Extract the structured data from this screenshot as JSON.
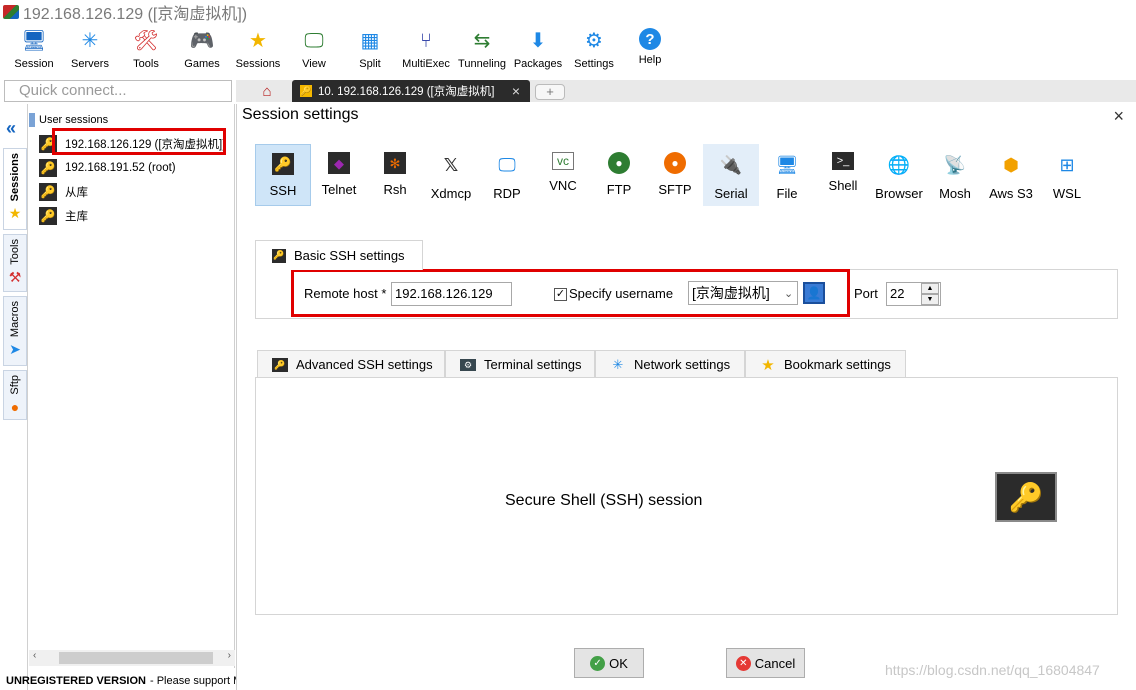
{
  "window": {
    "title": "192.168.126.129 ([京淘虚拟机])"
  },
  "toolbar": [
    {
      "label": "Session",
      "icon": "session-icon",
      "glyph": "🖥"
    },
    {
      "label": "Servers",
      "icon": "servers-icon",
      "glyph": "✳"
    },
    {
      "label": "Tools",
      "icon": "tools-icon",
      "glyph": "🛠"
    },
    {
      "label": "Games",
      "icon": "games-icon",
      "glyph": "🎮"
    },
    {
      "label": "Sessions",
      "icon": "star-icon",
      "glyph": "★"
    },
    {
      "label": "View",
      "icon": "view-icon",
      "glyph": "🖵"
    },
    {
      "label": "Split",
      "icon": "split-icon",
      "glyph": "▦"
    },
    {
      "label": "MultiExec",
      "icon": "multiexec-icon",
      "glyph": "⑂"
    },
    {
      "label": "Tunneling",
      "icon": "tunneling-icon",
      "glyph": "⇆"
    },
    {
      "label": "Packages",
      "icon": "packages-icon",
      "glyph": "⬇"
    },
    {
      "label": "Settings",
      "icon": "gear-icon",
      "glyph": "⚙"
    },
    {
      "label": "Help",
      "icon": "help-icon",
      "glyph": "?"
    }
  ],
  "quick_connect": {
    "placeholder": "Quick connect..."
  },
  "tabs": {
    "session_tab_label": "10. 192.168.126.129 ([京淘虚拟机]",
    "close": "×",
    "new_tab": "+"
  },
  "side_tabs": [
    "Sessions",
    "Tools",
    "Macros",
    "Sftp"
  ],
  "sessions_panel": {
    "header": "User sessions",
    "items": [
      "192.168.126.129 ([京淘虚拟机])",
      "192.168.191.52 (root)",
      "从库",
      "主库"
    ]
  },
  "status": {
    "bold": "UNREGISTERED VERSION",
    "rest": "-  Please support M"
  },
  "dialog": {
    "title": "Session settings",
    "close": "×",
    "session_types": [
      "SSH",
      "Telnet",
      "Rsh",
      "Xdmcp",
      "RDP",
      "VNC",
      "FTP",
      "SFTP",
      "Serial",
      "File",
      "Shell",
      "Browser",
      "Mosh",
      "Aws S3",
      "WSL"
    ],
    "selected_type": "SSH",
    "basic_tab": "Basic SSH settings",
    "remote_host_label": "Remote host *",
    "remote_host_value": "192.168.126.129",
    "specify_username_label": "Specify username",
    "specify_username_checked": true,
    "username_value": "[京淘虚拟机]",
    "port_label": "Port",
    "port_value": "22",
    "sub_tabs": [
      "Advanced SSH settings",
      "Terminal settings",
      "Network settings",
      "Bookmark settings"
    ],
    "description": "Secure Shell (SSH) session",
    "ok": "OK",
    "cancel": "Cancel"
  },
  "watermark": "https://blog.csdn.net/qq_16804847",
  "colors": {
    "highlight": "#e00000",
    "selected_bg": "#cfe5f8",
    "key_bg": "#2b2b2b",
    "key_fg": "#f5b800"
  }
}
